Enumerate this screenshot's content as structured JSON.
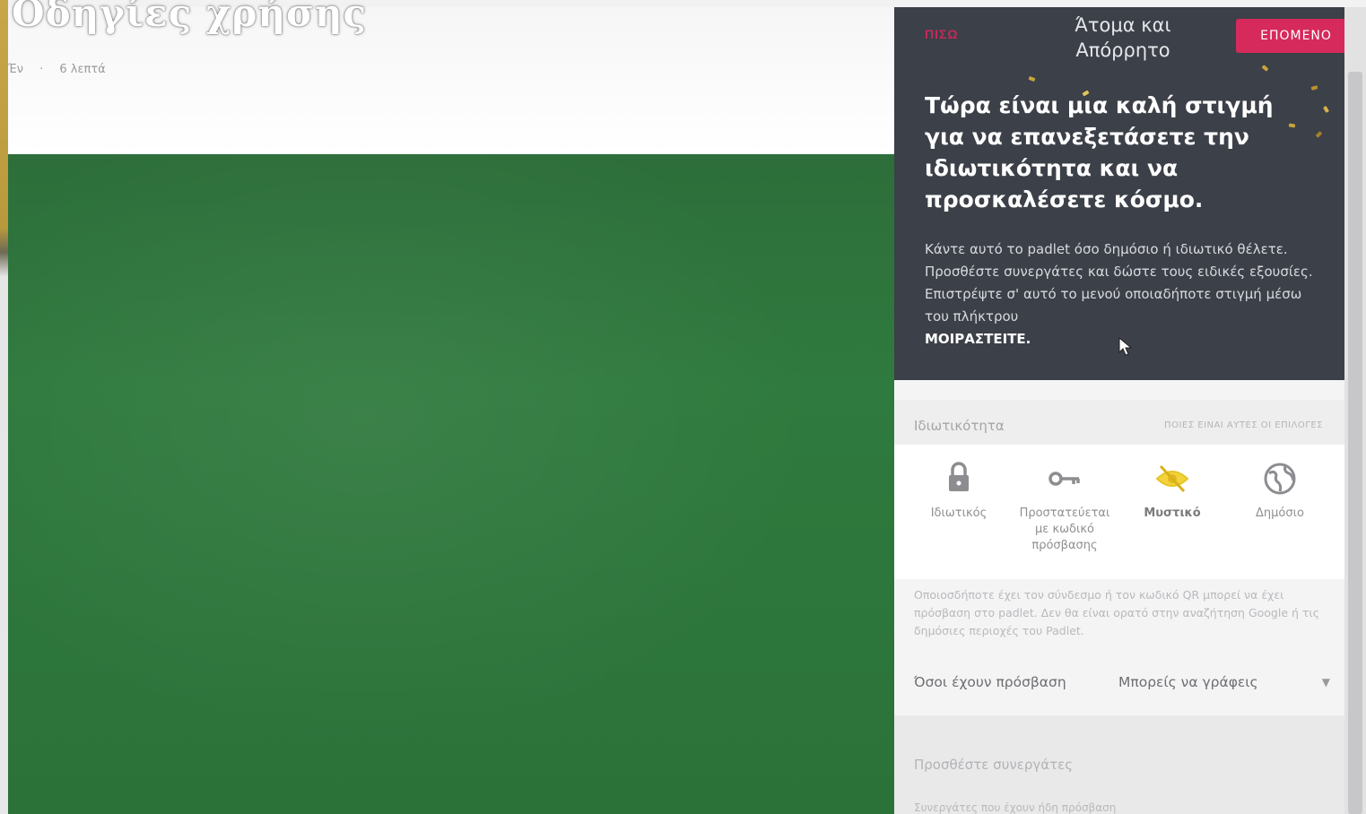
{
  "page": {
    "title": "Οδηγίες χρήσης",
    "breadcrumb": [
      "Έν",
      "6 λεπτά"
    ]
  },
  "panel": {
    "prev_label": "ΠΙΣΩ",
    "title": "Άτομα και Απόρρητο",
    "next_label": "ΕΠΟΜΕΝΟ",
    "headline": "Τώρα είναι μια καλή στιγμή για να επανεξετάσετε την ιδιωτικότητα και να προσκαλέσετε κόσμο.",
    "description": "Κάντε αυτό το padlet όσο δημόσιο ή ιδιωτικό θέλετε. Προσθέστε συνεργάτες και δώστε τους ειδικές εξουσίες. Επιστρέψτε σ' αυτό το μενού οποιαδήποτε στιγμή μέσω του πλήκτρου",
    "description_strong": "ΜΟΙΡΑΣΤΕΙΤΕ."
  },
  "privacy": {
    "label": "Ιδιωτικότητα",
    "link": "ΠΟΙΕΣ ΕΙΝΑΙ ΑΥΤΕΣ ΟΙ ΕΠΙΛΟΓΕΣ",
    "options": [
      {
        "label": "Ιδιωτικός",
        "icon": "lock-icon"
      },
      {
        "label": "Προστατεύεται με κωδικό πρόσβασης",
        "icon": "key-icon"
      },
      {
        "label": "Μυστικό",
        "icon": "hidden-eye-icon",
        "selected": true
      },
      {
        "label": "Δημόσιο",
        "icon": "globe-icon"
      }
    ],
    "help": "Οποιοσδήποτε έχει τον σύνδεσμο ή τον κωδικό QR μπορεί να έχει πρόσβαση στο padlet. Δεν θα είναι ορατό στην αναζήτηση Google ή τις δημόσιες περιοχές του Padlet."
  },
  "access": {
    "label": "Όσοι έχουν πρόσβαση",
    "value": "Μπορείς να γράφεις"
  },
  "collaborators": {
    "label": "Προσθέστε συνεργάτες",
    "sub": "Συνεργάτες που έχουν ήδη πρόσβαση"
  },
  "colors": {
    "panel_dark": "#3c4048",
    "accent_pink": "#d6295c",
    "board_green": "#2f7a3e",
    "selected_yellow": "#f2d43a"
  }
}
